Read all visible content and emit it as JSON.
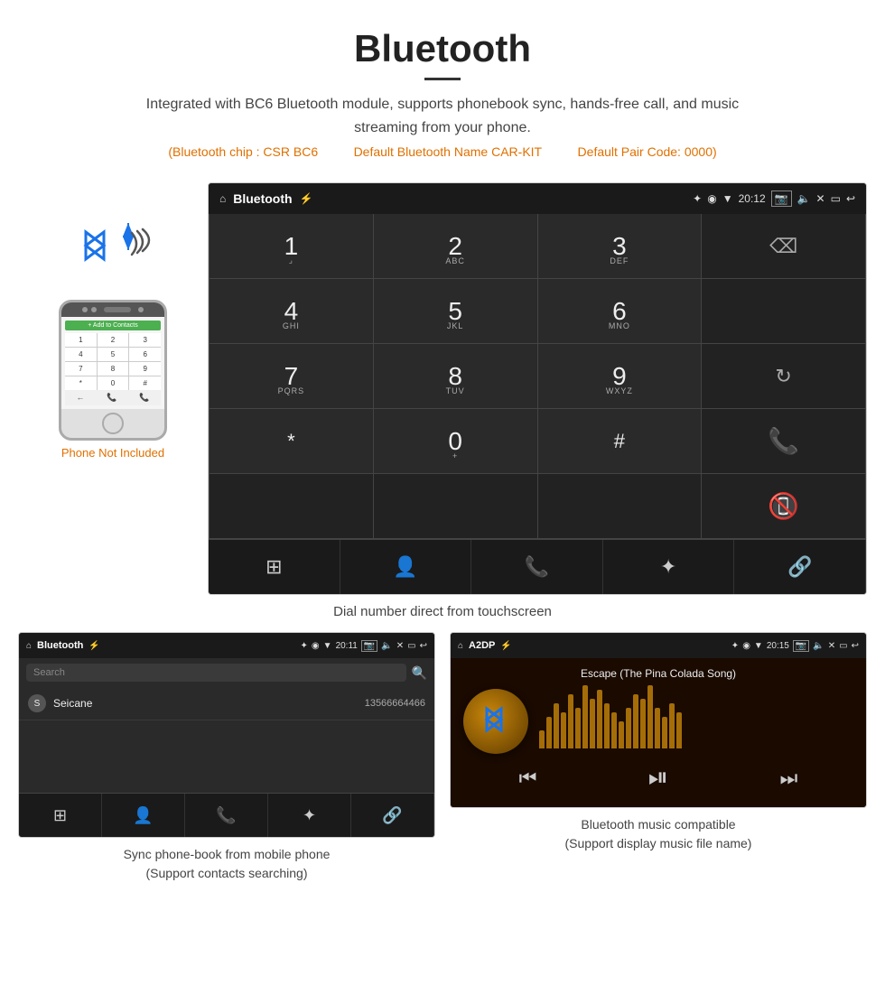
{
  "header": {
    "title": "Bluetooth",
    "description": "Integrated with BC6 Bluetooth module, supports phonebook sync, hands-free call, and music streaming from your phone.",
    "specs": {
      "chip": "(Bluetooth chip : CSR BC6",
      "name": "Default Bluetooth Name CAR-KIT",
      "pair": "Default Pair Code: 0000)"
    }
  },
  "phone_area": {
    "not_included": "Phone Not Included"
  },
  "car_screen": {
    "status_bar": {
      "title": "Bluetooth",
      "time": "20:12",
      "usb_icon": "⚡",
      "bt_icon": "✦",
      "location_icon": "◉",
      "signal_icon": "▼",
      "camera_icon": "⬜",
      "volume_icon": "🔈",
      "close_icon": "✕",
      "window_icon": "▭",
      "back_icon": "↩"
    },
    "dialpad": {
      "keys": [
        {
          "num": "1",
          "sub": "⌟",
          "row": 0
        },
        {
          "num": "2",
          "sub": "ABC",
          "row": 0
        },
        {
          "num": "3",
          "sub": "DEF",
          "row": 0
        },
        {
          "num": "4",
          "sub": "GHI",
          "row": 1
        },
        {
          "num": "5",
          "sub": "JKL",
          "row": 1
        },
        {
          "num": "6",
          "sub": "MNO",
          "row": 1
        },
        {
          "num": "7",
          "sub": "PQRS",
          "row": 2
        },
        {
          "num": "8",
          "sub": "TUV",
          "row": 2
        },
        {
          "num": "9",
          "sub": "WXYZ",
          "row": 2
        },
        {
          "num": "*",
          "sub": "",
          "row": 3
        },
        {
          "num": "0",
          "sub": "+",
          "row": 3
        },
        {
          "num": "#",
          "sub": "",
          "row": 3
        }
      ]
    },
    "nav_icons": [
      "⊞",
      "👤",
      "📞",
      "✦",
      "🔗"
    ]
  },
  "caption_main": "Dial number direct from touchscreen",
  "phonebook_screen": {
    "status_bar": {
      "title": "Bluetooth",
      "time": "20:11"
    },
    "search_placeholder": "Search",
    "contacts": [
      {
        "initial": "S",
        "name": "Seicane",
        "number": "13566664466"
      }
    ],
    "nav_icons": [
      "⊞",
      "👤",
      "📞",
      "✦",
      "🔗"
    ]
  },
  "caption_pb": "Sync phone-book from mobile phone\n(Support contacts searching)",
  "a2dp_screen": {
    "status_bar": {
      "title": "A2DP",
      "time": "20:15"
    },
    "song_title": "Escape (The Pina Colada Song)",
    "viz_bars": [
      20,
      35,
      50,
      40,
      60,
      45,
      70,
      55,
      65,
      50,
      40,
      30,
      45,
      60,
      55,
      70,
      45,
      35,
      50,
      40
    ],
    "controls": {
      "prev": "⏮",
      "play": "⏯",
      "next": "⏭"
    }
  },
  "caption_a2dp": "Bluetooth music compatible\n(Support display music file name)",
  "phone_dialpad_keys": [
    "1",
    "2",
    "3",
    "4",
    "5",
    "6",
    "7",
    "8",
    "9",
    "*",
    "0",
    "#"
  ],
  "phone_bottom_green": "📞",
  "phone_add_contact": "+ Add to Contacts"
}
